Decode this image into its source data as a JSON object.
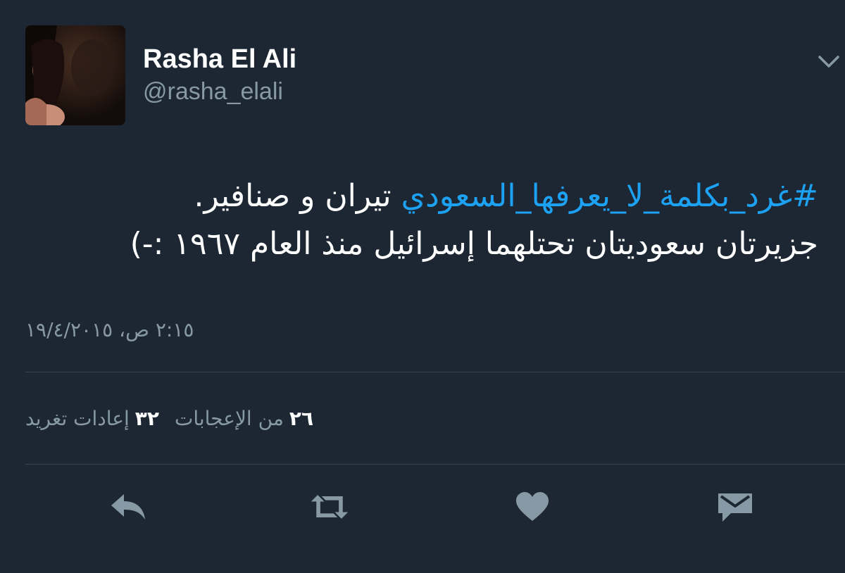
{
  "user": {
    "display_name": "Rasha El Ali",
    "handle": "@rasha_elali"
  },
  "tweet": {
    "hashtag": "#غرد_بكلمة_لا_يعرفها_السعودي",
    "line1_rest": " تيران و صنافير.",
    "line2": "جزيرتان سعوديتان تحتلهما إسرائيل منذ العام ١٩٦٧ :-)",
    "timestamp": "٢:١٥ ص، ١٩/٤/٢٠١٥"
  },
  "stats": {
    "retweets_count": "٣٢",
    "retweets_label": "إعادات تغريد",
    "likes_count": "٢٦",
    "likes_label": "من الإعجابات"
  },
  "colors": {
    "background": "#1c2733",
    "hashtag": "#1da1f2",
    "secondary_text": "#8899a6",
    "divider": "#38444d",
    "icon": "#8899a6"
  },
  "icons": {
    "caret": "chevron-down-icon",
    "reply": "reply-icon",
    "retweet": "retweet-icon",
    "like": "heart-icon",
    "dm": "envelope-icon"
  }
}
